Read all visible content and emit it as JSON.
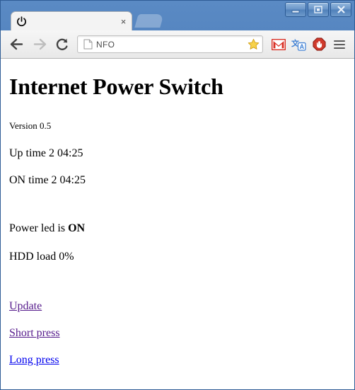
{
  "window": {
    "buttons": {
      "minimize": "minimize",
      "maximize": "restore",
      "close": "close"
    }
  },
  "browser": {
    "tab": {
      "favicon": "power-icon",
      "title": "",
      "close_label": "×"
    },
    "new_tab_label": "",
    "toolbar": {
      "back_label": "←",
      "forward_label": "→",
      "reload_label": "↻",
      "omnibox": {
        "page_icon": "page-icon",
        "url_blurred": "",
        "url_visible_tail": "NFO",
        "star_icon": "star-icon",
        "star_state": "bookmarked"
      },
      "extensions": [
        {
          "name": "gmail-extension",
          "label": "M"
        },
        {
          "name": "google-translate-extension",
          "label": "A"
        },
        {
          "name": "adblock-extension",
          "label": ""
        }
      ],
      "menu_label": "menu"
    }
  },
  "page": {
    "heading": "Internet Power Switch",
    "version": "Version 0.5",
    "uptime": "Up time 2 04:25",
    "ontime": "ON time 2 04:25",
    "power_led_prefix": "Power led is ",
    "power_led_state": "ON",
    "hdd_load": "HDD load 0%",
    "links": [
      {
        "label": "Update",
        "state": "visited"
      },
      {
        "label": "Short press",
        "state": "visited"
      },
      {
        "label": "Long press",
        "state": "unvisited"
      }
    ]
  },
  "colors": {
    "window_frame": "#3f6fae",
    "link_visited": "#551a8b",
    "link_unvisited": "#0000ee",
    "star": "#f3c13a",
    "gmail_red": "#d93025",
    "adblock_red": "#d03a2c",
    "page_bg": "#ffffff",
    "text": "#000000"
  }
}
